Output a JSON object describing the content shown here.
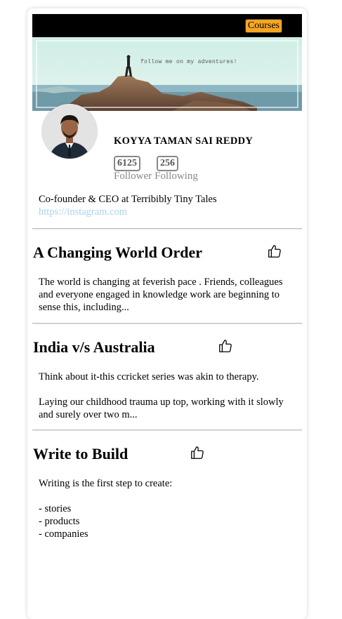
{
  "header": {
    "courses_label": "Courses"
  },
  "banner": {
    "text": "follow me on my adventures!"
  },
  "profile": {
    "name": "KOYYA TAMAN SAI REDDY",
    "followers": "6125",
    "following": "256",
    "followers_label": "Follower",
    "following_label": "Following",
    "bio": "Co-founder & CEO at Terribibly Tiny Tales",
    "link": "https://instagram.com"
  },
  "posts": [
    {
      "title": "A Changing World Order",
      "body": [
        "The world is changing at feverish pace . Friends, colleagues",
        "and everyone engaged in knowledge work are beginning to",
        "sense this, including..."
      ]
    },
    {
      "title": "India v/s Australia",
      "body": [
        "Think about it-this ccricket series was akin to therapy.",
        "",
        "Laying our childhood trauma up top, working with it slowly",
        "and surely over two m..."
      ]
    },
    {
      "title": "Write to Build",
      "body": [
        "Writing is the first step to create:",
        "",
        "- stories",
        "- products",
        "- companies"
      ]
    }
  ],
  "icons": {
    "like": "thumbs-up-icon",
    "avatar": "profile-photo"
  },
  "colors": {
    "accent": "#f5a623",
    "link": "#a8d4f0",
    "topbar": "#000000"
  }
}
